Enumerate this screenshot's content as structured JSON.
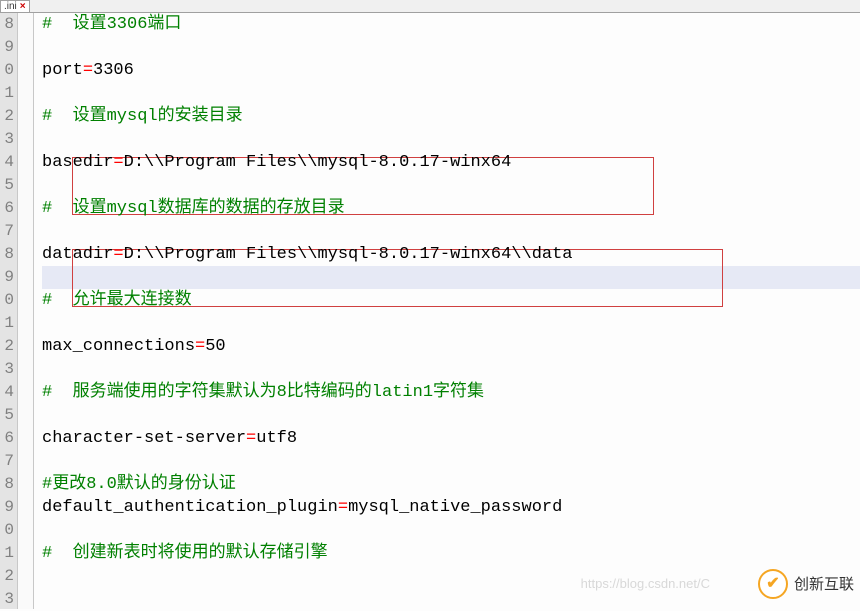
{
  "tab": {
    "name": ".ini",
    "close": "×"
  },
  "gutter_start": 8,
  "gutter_count": 26,
  "highlight_row_index": 11,
  "lines": [
    {
      "parts": [
        {
          "cls": "comment",
          "t": "#"
        },
        {
          "cls": "comment",
          "t": "  设置3306端口"
        }
      ]
    },
    {
      "parts": []
    },
    {
      "parts": [
        {
          "cls": "txt",
          "t": "port"
        },
        {
          "cls": "op",
          "t": "="
        },
        {
          "cls": "txt",
          "t": "3306"
        }
      ]
    },
    {
      "parts": []
    },
    {
      "parts": [
        {
          "cls": "comment",
          "t": "#"
        },
        {
          "cls": "comment",
          "t": "  设置mysql的安装目录"
        }
      ]
    },
    {
      "parts": []
    },
    {
      "parts": [
        {
          "cls": "txt",
          "t": "basedir"
        },
        {
          "cls": "op",
          "t": "="
        },
        {
          "cls": "txt",
          "t": "D:\\\\Program Files\\\\mysql-8.0.17-winx64"
        }
      ]
    },
    {
      "parts": []
    },
    {
      "parts": [
        {
          "cls": "comment",
          "t": "#"
        },
        {
          "cls": "comment",
          "t": "  设置mysql数据库的数据的存放目录"
        }
      ]
    },
    {
      "parts": []
    },
    {
      "parts": [
        {
          "cls": "txt",
          "t": "datadir"
        },
        {
          "cls": "op",
          "t": "="
        },
        {
          "cls": "txt",
          "t": "D:\\\\Program Files\\\\mysql-8.0.17-winx64\\\\data"
        }
      ]
    },
    {
      "parts": []
    },
    {
      "parts": [
        {
          "cls": "comment",
          "t": "#"
        },
        {
          "cls": "comment",
          "t": "  允许最大连接数"
        }
      ]
    },
    {
      "parts": []
    },
    {
      "parts": [
        {
          "cls": "txt",
          "t": "max_connections"
        },
        {
          "cls": "op",
          "t": "="
        },
        {
          "cls": "txt",
          "t": "50"
        }
      ]
    },
    {
      "parts": []
    },
    {
      "parts": [
        {
          "cls": "comment",
          "t": "#"
        },
        {
          "cls": "comment",
          "t": "  服务端使用的字符集默认为8比特编码的latin1字符集"
        }
      ]
    },
    {
      "parts": []
    },
    {
      "parts": [
        {
          "cls": "txt",
          "t": "character-set-server"
        },
        {
          "cls": "op",
          "t": "="
        },
        {
          "cls": "txt",
          "t": "utf8"
        }
      ]
    },
    {
      "parts": []
    },
    {
      "parts": [
        {
          "cls": "comment",
          "t": "#更改8.0默认的身份认证"
        }
      ]
    },
    {
      "parts": [
        {
          "cls": "txt",
          "t": "default_authentication_plugin"
        },
        {
          "cls": "op",
          "t": "="
        },
        {
          "cls": "txt",
          "t": "mysql_native_password"
        }
      ]
    },
    {
      "parts": []
    },
    {
      "parts": [
        {
          "cls": "comment",
          "t": "#"
        },
        {
          "cls": "comment",
          "t": "  创建新表时将使用的默认存储引擎"
        }
      ]
    },
    {
      "parts": []
    }
  ],
  "watermark": {
    "brand": "创新互联",
    "url": "https://blog.csdn.net/C"
  }
}
